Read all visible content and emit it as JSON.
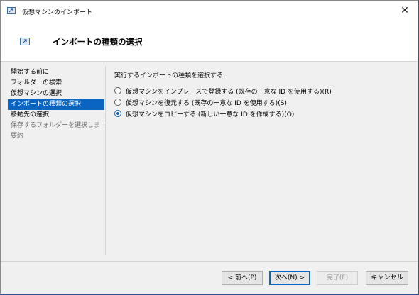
{
  "window": {
    "title": "仮想マシンのインポート",
    "close_icon": "close-icon"
  },
  "header": {
    "title": "インポートの種類の選択",
    "icon": "import-vm-icon"
  },
  "sidebar": {
    "items": [
      {
        "label": "開始する前に",
        "state": "normal"
      },
      {
        "label": "フォルダーの検索",
        "state": "normal"
      },
      {
        "label": "仮想マシンの選択",
        "state": "normal"
      },
      {
        "label": "インポートの種類の選択",
        "state": "selected"
      },
      {
        "label": "移動先の選択",
        "state": "normal"
      },
      {
        "label": "保存するフォルダーを選択しま す",
        "state": "disabled"
      },
      {
        "label": "要約",
        "state": "disabled"
      }
    ]
  },
  "main": {
    "prompt": "実行するインポートの種類を選択する:",
    "options": [
      {
        "label": "仮想マシンをインプレースで登録する (既存の一意な ID を使用する)(R)",
        "checked": false
      },
      {
        "label": "仮想マシンを復元する (既存の一意な ID を使用する)(S)",
        "checked": false
      },
      {
        "label": "仮想マシンをコピーする (新しい一意な ID を作成する)(O)",
        "checked": true
      }
    ]
  },
  "footer": {
    "prev_label": "< 前へ(P)",
    "next_label": "次へ(N) >",
    "finish_label": "完了(F)",
    "cancel_label": "キャンセル"
  },
  "colors": {
    "selection": "#0a64c2",
    "background": "#f0f0f0",
    "desktop": "#2b5797"
  }
}
